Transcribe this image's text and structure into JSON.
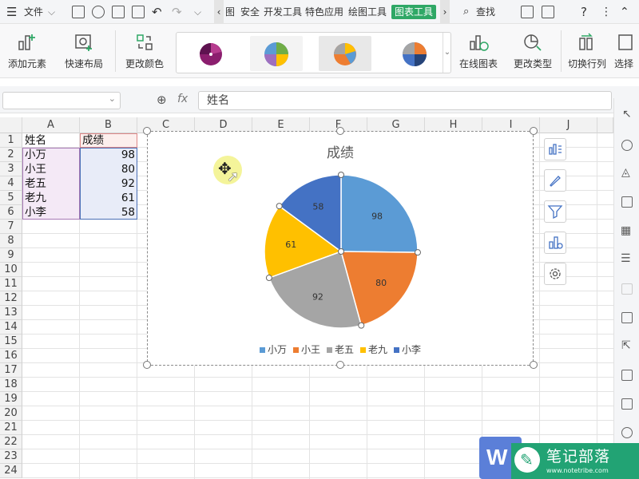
{
  "menubar": {
    "file_label": "文件",
    "tabs": [
      "图",
      "安全",
      "开发工具",
      "特色应用",
      "绘图工具",
      "图表工具"
    ],
    "active_tab": "图表工具",
    "search_label": "查找"
  },
  "ribbon": {
    "add_element": "添加元素",
    "quick_layout": "快速布局",
    "change_color": "更改颜色",
    "online_chart": "在线图表",
    "change_type": "更改类型",
    "switch_row_col": "切换行列",
    "select_data": "选择"
  },
  "formula_bar": {
    "namebox_value": "",
    "fx_label": "fx",
    "formula_value": "姓名"
  },
  "columns": [
    "A",
    "B",
    "C",
    "D",
    "E",
    "F",
    "G",
    "H",
    "I",
    "J"
  ],
  "rows": [
    "1",
    "2",
    "3",
    "4",
    "5",
    "6",
    "7",
    "8",
    "9",
    "10",
    "11",
    "12",
    "13",
    "14",
    "15",
    "16",
    "17",
    "18",
    "19",
    "20",
    "21",
    "22",
    "23",
    "24"
  ],
  "sheet": {
    "header_name": "姓名",
    "header_score": "成绩",
    "records": [
      {
        "name": "小万",
        "score": "98"
      },
      {
        "name": "小王",
        "score": "80"
      },
      {
        "name": "老五",
        "score": "92"
      },
      {
        "name": "老九",
        "score": "61"
      },
      {
        "name": "小李",
        "score": "58"
      }
    ]
  },
  "chart_data": {
    "type": "pie",
    "title": "成绩",
    "categories": [
      "小万",
      "小王",
      "老五",
      "老九",
      "小李"
    ],
    "values": [
      98,
      80,
      92,
      61,
      58
    ],
    "colors": [
      "#5b9bd5",
      "#ed7d31",
      "#a5a5a5",
      "#ffc000",
      "#4472c4"
    ],
    "legend": "bottom"
  },
  "watermark": {
    "text": "笔记部落",
    "url": "www.notetribe.com"
  }
}
